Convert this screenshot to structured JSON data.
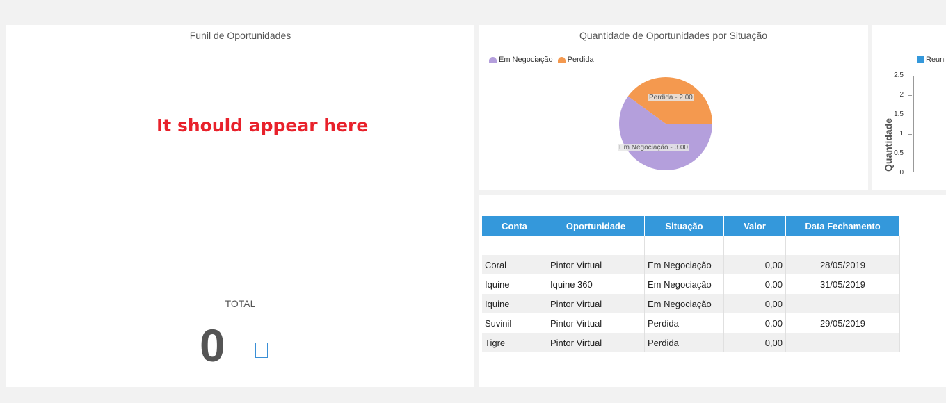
{
  "funnel": {
    "title": "Funil de Oportunidades",
    "annotation": "It should appear here",
    "total_label": "TOTAL",
    "total_value": "0"
  },
  "pie": {
    "title": "Quantidade de Oportunidades por Situação",
    "legend": [
      {
        "label": "Em Negociação",
        "color": "#b49fdc"
      },
      {
        "label": "Perdida",
        "color": "#f4994f"
      }
    ]
  },
  "bar": {
    "legend_label": "Reuni",
    "legend_color": "#3498db",
    "ylabel": "Quantidade",
    "ticks": [
      "2.5",
      "2",
      "1.5",
      "1",
      "0.5",
      "0"
    ]
  },
  "table": {
    "headers": [
      "Conta",
      "Oportunidade",
      "Situação",
      "Valor",
      "Data Fechamento"
    ],
    "rows": [
      [
        "",
        "",
        "",
        "",
        ""
      ],
      [
        "Coral",
        "Pintor Virtual",
        "Em Negociação",
        "0,00",
        "28/05/2019"
      ],
      [
        "Iquine",
        "Iquine 360",
        "Em Negociação",
        "0,00",
        "31/05/2019"
      ],
      [
        "Iquine",
        "Pintor Virtual",
        "Em Negociação",
        "0,00",
        ""
      ],
      [
        "Suvinil",
        "Pintor Virtual",
        "Perdida",
        "0,00",
        "29/05/2019"
      ],
      [
        "Tigre",
        "Pintor Virtual",
        "Perdida",
        "0,00",
        ""
      ]
    ]
  },
  "chart_data": [
    {
      "type": "pie",
      "title": "Quantidade de Oportunidades por Situação",
      "categories": [
        "Em Negociação",
        "Perdida"
      ],
      "values": [
        3,
        2
      ],
      "data_labels": [
        "Em Negociação - 3.00",
        "Perdida - 2.00"
      ],
      "colors": [
        "#b49fdc",
        "#f4994f"
      ],
      "legend_position": "top-left"
    },
    {
      "type": "bar",
      "title": "",
      "ylabel": "Quantidade",
      "ylim": [
        0,
        2.5
      ],
      "series": [
        {
          "name": "Reuni",
          "values": []
        }
      ],
      "legend_position": "top"
    }
  ]
}
